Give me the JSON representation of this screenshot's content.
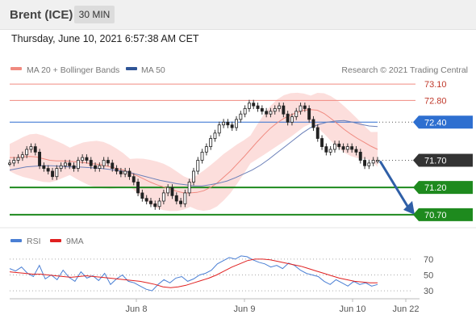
{
  "header": {
    "instrument": "Brent (ICE)",
    "interval": "30 MIN",
    "timestamp": "Thursday, June 10, 2021 6:57:38 AM CET"
  },
  "legend": {
    "ma20_label": "MA 20 + Bollinger Bands",
    "ma20_color": "#f08a80",
    "ma50_label": "MA 50",
    "ma50_color": "#2f5597",
    "watermark": "Research © 2021 Trading Central"
  },
  "chart_data": [
    {
      "type": "line",
      "title": "",
      "ylim": [
        70.55,
        73.25
      ],
      "x_labels": [
        "Jun 8",
        "Jun 9",
        "Jun 10",
        "Jun 22"
      ],
      "levels": [
        {
          "value": 73.1,
          "label": "73.10",
          "style": "resistance",
          "color": "#f08a80"
        },
        {
          "value": 72.8,
          "label": "72.80",
          "style": "resistance",
          "color": "#f08a80"
        },
        {
          "value": 72.4,
          "label": "72.40",
          "style": "pivot",
          "color": "#2e6fd0"
        },
        {
          "value": 71.7,
          "label": "71.70",
          "style": "last",
          "color": "#333333"
        },
        {
          "value": 71.2,
          "label": "71.20",
          "style": "support",
          "color": "#1e8a1e"
        },
        {
          "value": 70.7,
          "label": "70.70",
          "style": "support",
          "color": "#1e8a1e"
        }
      ],
      "arrow": {
        "from": 71.7,
        "to": 70.7,
        "color": "#2f5fa7"
      },
      "series": [
        {
          "name": "Price",
          "values": [
            71.65,
            71.7,
            71.75,
            71.8,
            71.9,
            71.95,
            71.85,
            71.6,
            71.55,
            71.5,
            71.4,
            71.55,
            71.6,
            71.65,
            71.6,
            71.55,
            71.7,
            71.75,
            71.7,
            71.6,
            71.55,
            71.6,
            71.7,
            71.65,
            71.55,
            71.5,
            71.45,
            71.5,
            71.4,
            71.3,
            71.1,
            71.0,
            70.95,
            70.9,
            70.85,
            70.95,
            71.1,
            71.2,
            71.05,
            70.95,
            70.9,
            71.1,
            71.3,
            71.5,
            71.7,
            71.85,
            71.95,
            72.1,
            72.2,
            72.35,
            72.4,
            72.35,
            72.3,
            72.45,
            72.55,
            72.65,
            72.75,
            72.7,
            72.65,
            72.6,
            72.55,
            72.6,
            72.65,
            72.7,
            72.55,
            72.4,
            72.5,
            72.6,
            72.7,
            72.65,
            72.45,
            72.3,
            72.1,
            71.95,
            71.85,
            71.9,
            72.0,
            71.95,
            71.9,
            71.95,
            71.9,
            71.85,
            71.7,
            71.6,
            71.65,
            71.7,
            71.7
          ]
        },
        {
          "name": "MA 20",
          "values": [
            71.75,
            71.75,
            71.76,
            71.77,
            71.76,
            71.73,
            71.7,
            71.69,
            71.69,
            71.68,
            71.67,
            71.66,
            71.64,
            71.63,
            71.61,
            71.58,
            71.55,
            71.52,
            71.47,
            71.42,
            71.36,
            71.3,
            71.25,
            71.21,
            71.17,
            71.13,
            71.1,
            71.1,
            71.11,
            71.14,
            71.2,
            71.28,
            71.39,
            71.5,
            71.63,
            71.76,
            71.9,
            72.04,
            72.17,
            72.29,
            72.39,
            72.47,
            72.53,
            72.58,
            72.62,
            72.63,
            72.62,
            72.56,
            72.47,
            72.37,
            72.27,
            72.18,
            72.1,
            72.03,
            71.96,
            71.9
          ]
        },
        {
          "name": "MA 50",
          "values": [
            71.52,
            71.55,
            71.58,
            71.59,
            71.6,
            71.6,
            71.59,
            71.58,
            71.58,
            71.57,
            71.56,
            71.55,
            71.53,
            71.51,
            71.49,
            71.45,
            71.41,
            71.37,
            71.33,
            71.3,
            71.27,
            71.25,
            71.23,
            71.23,
            71.25,
            71.28,
            71.32,
            71.38,
            71.45,
            71.52,
            71.61,
            71.72,
            71.84,
            71.96,
            72.08,
            72.2,
            72.3,
            72.36,
            72.4,
            72.42,
            72.43,
            72.4,
            72.36,
            72.33,
            72.32
          ]
        }
      ]
    },
    {
      "type": "line",
      "title": "",
      "ylim": [
        22,
        78
      ],
      "legend": [
        {
          "name": "RSI",
          "color": "#4a7fd4"
        },
        {
          "name": "9MA",
          "color": "#e02020"
        }
      ],
      "y_ticks": [
        70,
        50,
        30
      ],
      "series": [
        {
          "name": "RSI",
          "values": [
            58,
            55,
            60,
            52,
            48,
            62,
            45,
            50,
            44,
            56,
            47,
            42,
            54,
            46,
            49,
            43,
            52,
            38,
            45,
            50,
            42,
            40,
            36,
            32,
            30,
            38,
            44,
            40,
            46,
            48,
            42,
            45,
            50,
            52,
            56,
            64,
            68,
            72,
            70,
            74,
            73,
            69,
            66,
            64,
            60,
            62,
            58,
            65,
            62,
            56,
            52,
            50,
            48,
            42,
            38,
            44,
            40,
            36,
            42,
            38,
            40,
            36,
            38
          ]
        },
        {
          "name": "9MA",
          "values": [
            54,
            53,
            52,
            51,
            51,
            50,
            49,
            48,
            47,
            48,
            49,
            48,
            47,
            46,
            45,
            44,
            43,
            42,
            40,
            38,
            35,
            34,
            35,
            37,
            40,
            43,
            46,
            50,
            55,
            60,
            64,
            68,
            70,
            70,
            69,
            67,
            65,
            63,
            61,
            58,
            55,
            52,
            49,
            46,
            44,
            42,
            41,
            40,
            40
          ]
        }
      ]
    }
  ]
}
